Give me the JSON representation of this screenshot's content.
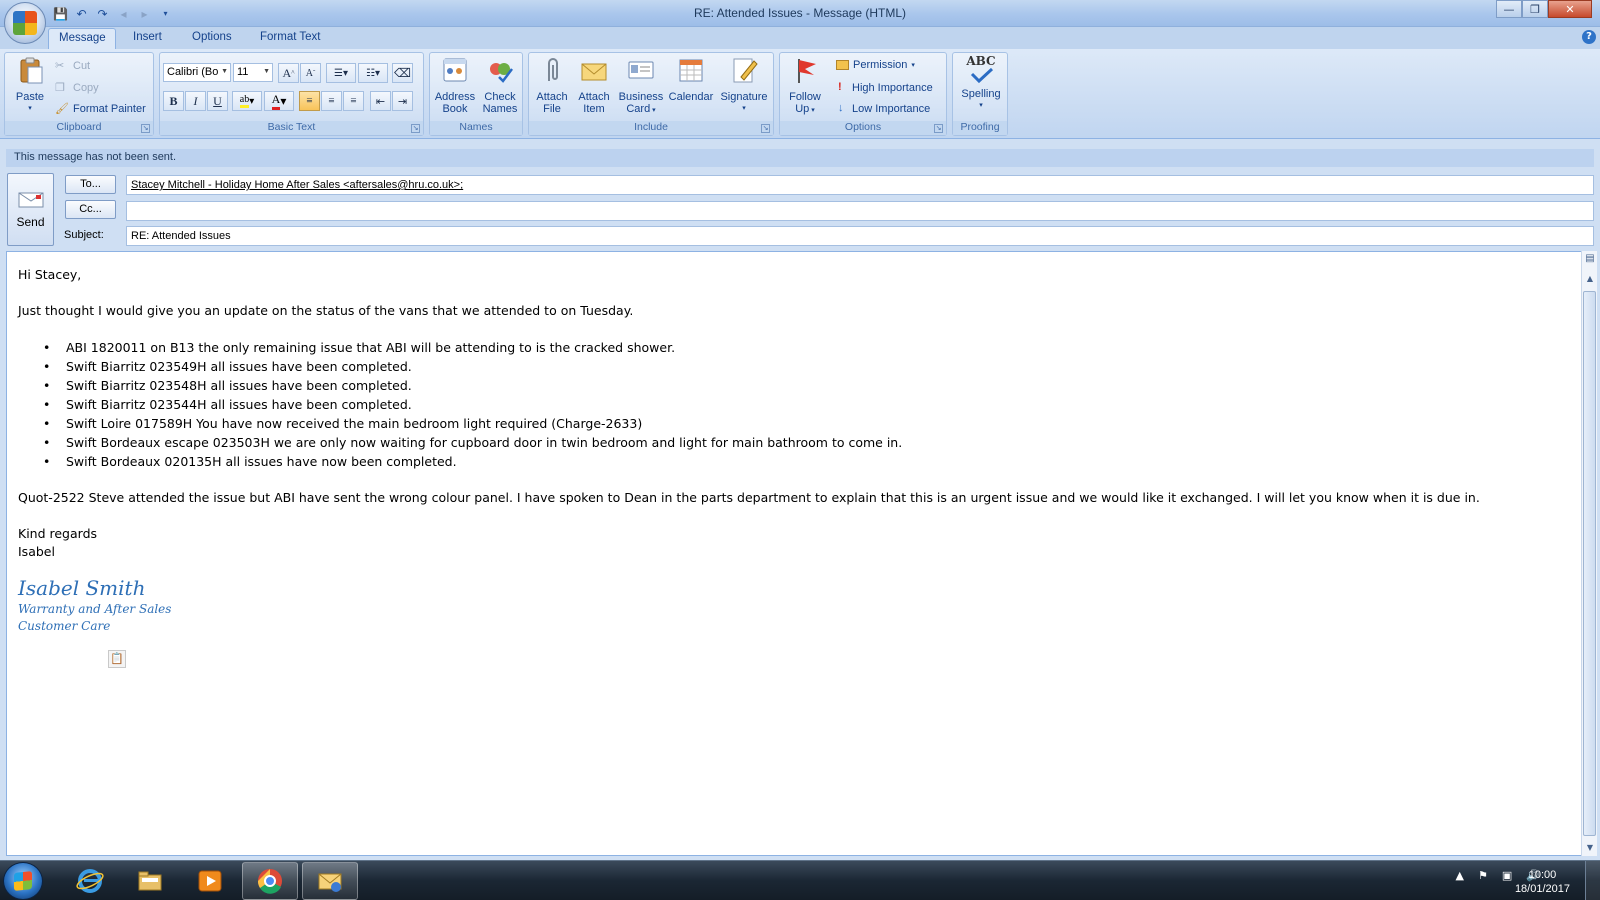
{
  "window": {
    "title": "RE: Attended Issues - Message (HTML)"
  },
  "tabs": [
    "Message",
    "Insert",
    "Options",
    "Format Text"
  ],
  "ribbon": {
    "clipboard": {
      "label": "Clipboard",
      "paste": "Paste",
      "cut": "Cut",
      "copy": "Copy",
      "format_painter": "Format Painter"
    },
    "basic_text": {
      "label": "Basic Text",
      "font": "Calibri (Bo",
      "size": "11"
    },
    "names": {
      "label": "Names",
      "address_book": [
        "Address",
        "Book"
      ],
      "check_names": [
        "Check",
        "Names"
      ]
    },
    "include": {
      "label": "Include",
      "attach_file": [
        "Attach",
        "File"
      ],
      "attach_item": [
        "Attach",
        "Item"
      ],
      "business_card": [
        "Business",
        "Card"
      ],
      "calendar": "Calendar",
      "signature": "Signature"
    },
    "options": {
      "label": "Options",
      "follow_up": [
        "Follow",
        "Up"
      ],
      "permission": "Permission",
      "high_importance": "High Importance",
      "low_importance": "Low Importance"
    },
    "proofing": {
      "label": "Proofing",
      "spelling": "Spelling",
      "abc": "ABC"
    }
  },
  "infobar": "This message has not been sent.",
  "header": {
    "send": "Send",
    "to_button": "To...",
    "cc_button": "Cc...",
    "subject_label": "Subject:",
    "to": "Stacey Mitchell - Holiday Home After Sales <aftersales@hru.co.uk>;",
    "cc": "",
    "subject": "RE: Attended Issues"
  },
  "body": {
    "greeting": "Hi Stacey,",
    "intro": "Just thought I would give you an update on the status of the vans that we attended to on Tuesday.",
    "items": [
      "ABI 1820011 on B13 the only remaining issue that ABI will be attending to is the cracked shower.",
      "Swift Biarritz 023549H all issues have been completed.",
      "Swift Biarritz 023548H all issues have been completed.",
      "Swift Biarritz 023544H all issues have been completed.",
      "Swift Loire 017589H You have now received the main bedroom light required (Charge-2633)",
      "Swift Bordeaux escape 023503H we are only now waiting for cupboard door in twin bedroom and light for main bathroom to come in.",
      "Swift Bordeaux 020135H all issues have now been completed."
    ],
    "paragraph": "Quot-2522 Steve attended the issue but ABI have sent the wrong colour panel. I have spoken to Dean in the parts department to explain that this is an urgent issue and we would like it exchanged. I will let you know when it is due in.",
    "closing": "Kind regards",
    "name": "Isabel",
    "signature": {
      "name": "Isabel Smith",
      "line1": "Warranty and After Sales",
      "line2": "Customer Care"
    }
  },
  "taskbar": {
    "time": "10:00",
    "date": "18/01/2017"
  }
}
